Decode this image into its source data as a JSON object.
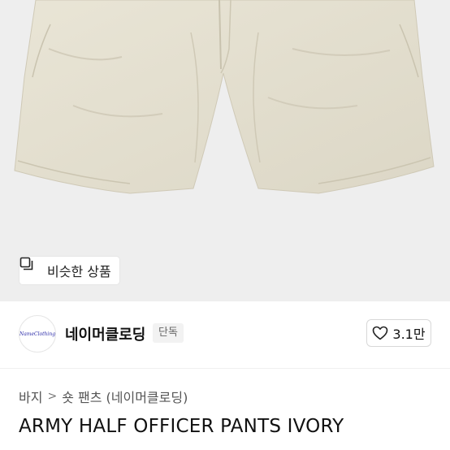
{
  "hero": {
    "similar_button": {
      "icon": "similar-products-icon",
      "label": "비슷한 상품"
    }
  },
  "seller": {
    "logo_text": "NameClothing",
    "name": "네이머클로딩",
    "badge": "단독",
    "like": {
      "icon": "heart-icon",
      "count": "3.1만"
    }
  },
  "breadcrumb": {
    "items": [
      "바지",
      "숏 팬츠 (네이머클로딩)"
    ]
  },
  "product": {
    "title": "ARMY HALF OFFICER PANTS IVORY"
  }
}
